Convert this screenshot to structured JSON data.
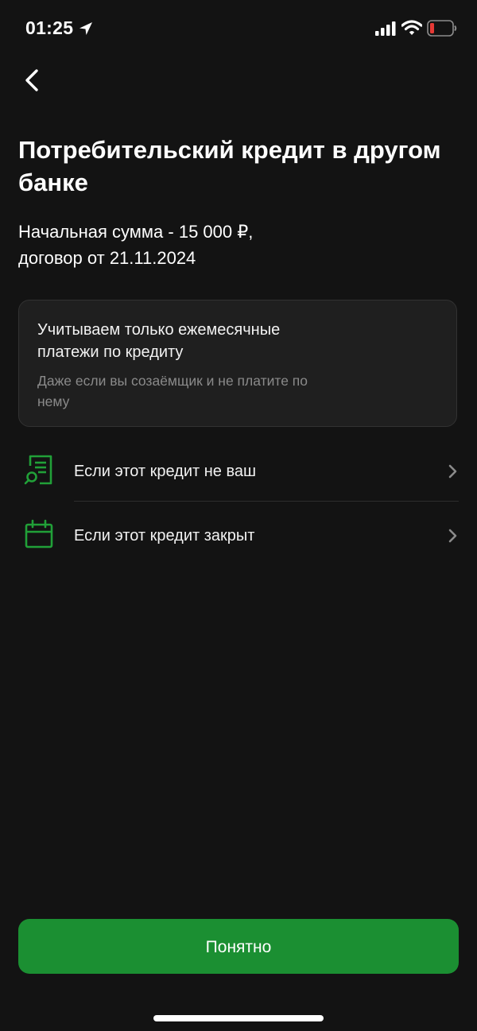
{
  "status_bar": {
    "time": "01:25",
    "battery_color": "#e53935"
  },
  "header": {
    "back_icon": "chevron-left-icon"
  },
  "title": "Потребительский кредит в другом банке",
  "subtitle": {
    "line1": "Начальная сумма - 15 000 ₽,",
    "line2": "договор от 21.11.2024"
  },
  "info_card": {
    "title": "Учитываем только ежемесячные платежи по кредиту",
    "text": "Даже если вы созаёмщик и не платите по нему"
  },
  "list": {
    "items": [
      {
        "label": "Если этот кредит не ваш",
        "icon": "document-search-icon"
      },
      {
        "label": "Если этот кредит закрыт",
        "icon": "calendar-icon"
      }
    ]
  },
  "primary_button": {
    "label": "Понятно"
  },
  "colors": {
    "background": "#131313",
    "card": "#1f1f1f",
    "accent": "#1b8f32",
    "icon_green": "#21a038",
    "muted_text": "#8a8a8a"
  }
}
